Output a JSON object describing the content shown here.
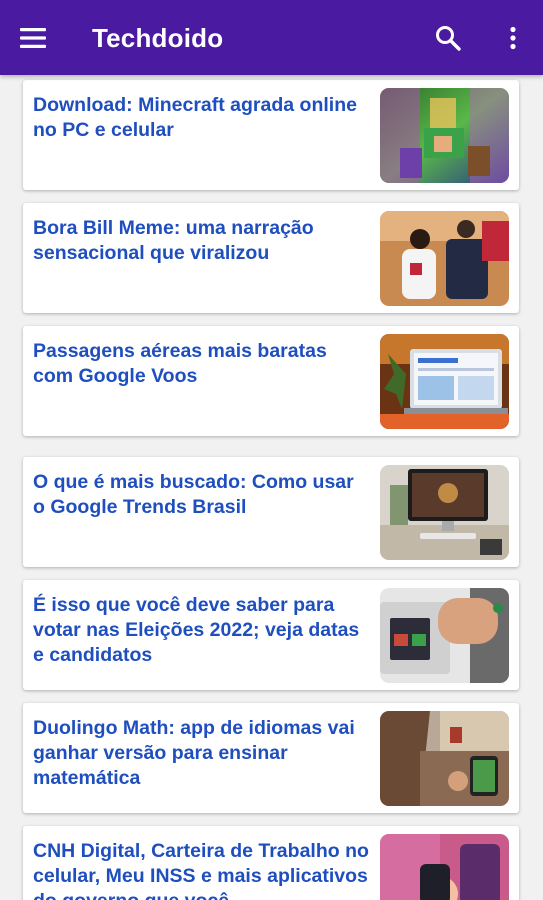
{
  "app": {
    "title": "Techdoido",
    "menu_icon": "hamburger-menu-icon",
    "search_icon": "search-icon",
    "more_icon": "more-vertical-icon",
    "colors": {
      "appbar": "#4a1aa0",
      "headline": "#1f4fbf",
      "background": "#f1f1f1"
    }
  },
  "articles": [
    {
      "title": "Download: Minecraft agrada online no PC e celular"
    },
    {
      "title": "Bora Bill Meme: uma narração sensacional que viralizou"
    },
    {
      "title": "Passagens aéreas mais baratas com Google Voos"
    },
    {
      "title": "O que é mais buscado: Como usar o Google Trends Brasil"
    },
    {
      "title": "É isso que você deve saber para votar nas Eleições 2022; veja datas e candidatos"
    },
    {
      "title": "Duolingo Math: app de idiomas vai ganhar versão para ensinar matemática"
    },
    {
      "title": "CNH Digital, Carteira de Trabalho no celular, Meu INSS e mais aplicativos do governo que você"
    }
  ]
}
